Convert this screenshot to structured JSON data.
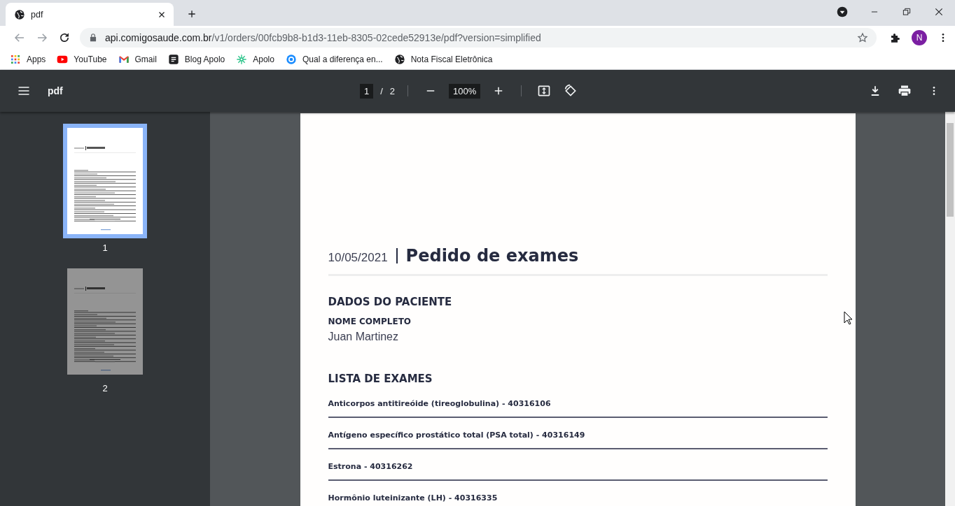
{
  "browser": {
    "tabs": [
      {
        "title": "pdf",
        "selected": true
      }
    ],
    "address": {
      "host": "api.comigosaude.com.br",
      "path": "/v1/orders/00fcb9b8-b1d3-11eb-8305-02cede52913e/pdf?version=simplified"
    },
    "profile_initial": "N",
    "bookmarks": [
      {
        "label": "Apps",
        "kind": "apps"
      },
      {
        "label": "YouTube",
        "kind": "youtube"
      },
      {
        "label": "Gmail",
        "kind": "gmail"
      },
      {
        "label": "Blog Apolo",
        "kind": "blog"
      },
      {
        "label": "Apolo",
        "kind": "apolo"
      },
      {
        "label": "Qual a diferença en...",
        "kind": "ring"
      },
      {
        "label": "Nota Fiscal Eletrônica",
        "kind": "globe"
      }
    ]
  },
  "viewer": {
    "title": "pdf",
    "page": "1",
    "separator": "/",
    "page_total": "2",
    "zoom": "100%"
  },
  "thumbnails": [
    {
      "label": "1",
      "selected": true,
      "loaded": true
    },
    {
      "label": "2",
      "selected": false,
      "loaded": false
    }
  ],
  "document": {
    "date": "10/05/2021",
    "title": "Pedido de exames",
    "patient": {
      "heading": "DADOS DO PACIENTE",
      "label": "NOME COMPLETO",
      "value": "Juan Martinez"
    },
    "exams": {
      "heading": "LISTA DE EXAMES",
      "items": [
        "Anticorpos antitireóide (tireoglobulina) - 40316106",
        "Antígeno específico prostático total (PSA total) - 40316149",
        "Estrona - 40316262",
        "Hormônio luteinizante (LH) - 40316335"
      ]
    }
  }
}
